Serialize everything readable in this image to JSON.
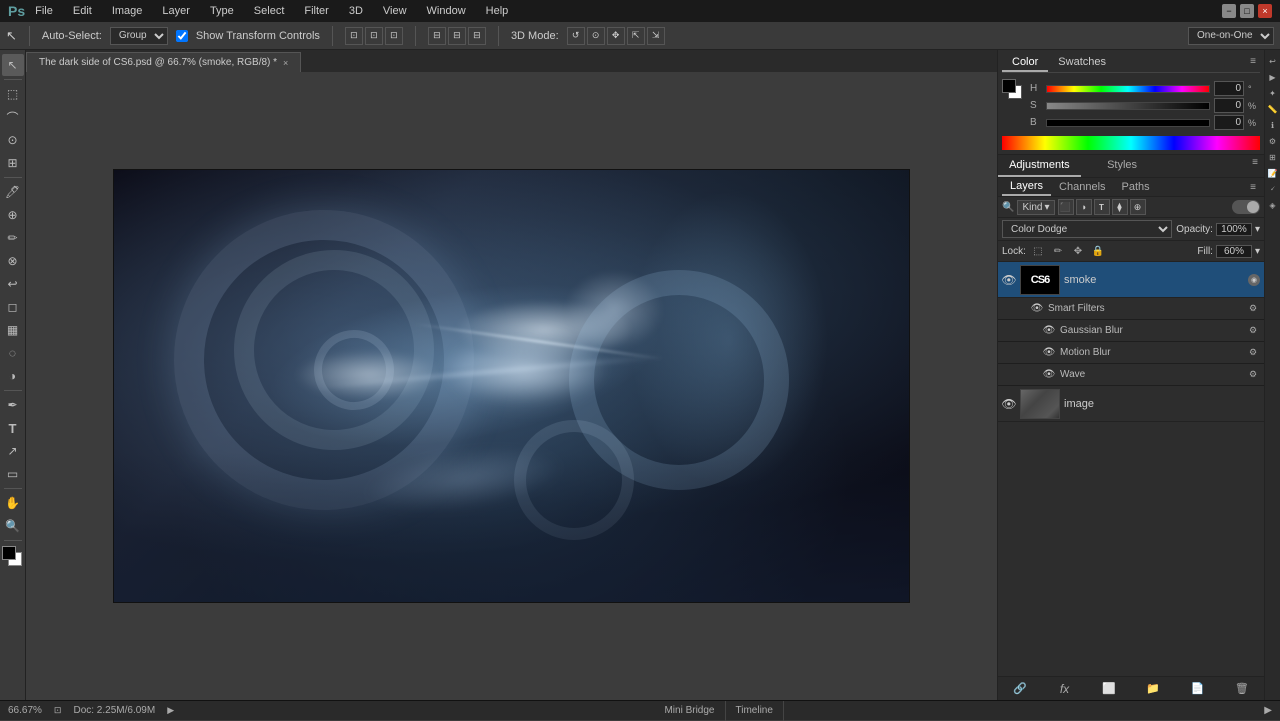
{
  "app": {
    "name": "Adobe Photoshop",
    "logo": "Ps",
    "mode": "One-on-One"
  },
  "titlebar": {
    "menus": [
      "File",
      "Edit",
      "Image",
      "Layer",
      "Type",
      "Select",
      "Filter",
      "3D",
      "View",
      "Window",
      "Help"
    ],
    "controls": [
      "−",
      "□",
      "×"
    ]
  },
  "options_bar": {
    "tool_icon": "↖",
    "auto_select_label": "Auto-Select:",
    "auto_select_value": "Group",
    "show_transform": "Show Transform Controls",
    "mode_label": "3D Mode:"
  },
  "tab": {
    "title": "The dark side of CS6.psd @ 66.7% (smoke, RGB/8) *",
    "close": "×"
  },
  "status_bar": {
    "zoom": "66.67%",
    "doc_size": "Doc: 2.25M/6.09M",
    "bottom_tabs": [
      "Mini Bridge",
      "Timeline"
    ],
    "bridge_label": "Bridge"
  },
  "color_panel": {
    "tabs": [
      "Color",
      "Swatches"
    ],
    "active_tab": "Color",
    "h_label": "H",
    "h_value": "0",
    "h_unit": "°",
    "s_label": "S",
    "s_value": "0",
    "s_unit": "%",
    "b_label": "B",
    "b_value": "0",
    "b_unit": "%"
  },
  "adj_panel": {
    "tabs": [
      "Adjustments",
      "Styles"
    ],
    "active_tab": "Adjustments"
  },
  "layers_panel": {
    "header_tabs": [
      "Layers",
      "Channels",
      "Paths"
    ],
    "active_tab": "Layers",
    "filter_kind": "Kind",
    "blend_mode": "Color Dodge",
    "opacity_label": "Opacity:",
    "opacity_value": "100%",
    "lock_label": "Lock:",
    "fill_label": "Fill:",
    "fill_value": "60%",
    "layers": [
      {
        "id": "layer-smoke",
        "visible": true,
        "name": "smoke",
        "selected": true,
        "thumb_type": "cs6",
        "has_badge": true,
        "sublayers": [
          {
            "id": "sublayer-smart-filters",
            "visible": true,
            "name": "Smart Filters",
            "indent": true,
            "is_header": true
          },
          {
            "id": "sublayer-gaussian",
            "visible": true,
            "name": "Gaussian Blur"
          },
          {
            "id": "sublayer-motion",
            "visible": true,
            "name": "Motion Blur"
          },
          {
            "id": "sublayer-wave",
            "visible": true,
            "name": "Wave"
          }
        ]
      },
      {
        "id": "layer-image",
        "visible": true,
        "name": "image",
        "selected": false,
        "thumb_type": "img"
      }
    ],
    "footer_buttons": [
      "🔗",
      "fx",
      "🗏",
      "📋",
      "🗑"
    ]
  }
}
